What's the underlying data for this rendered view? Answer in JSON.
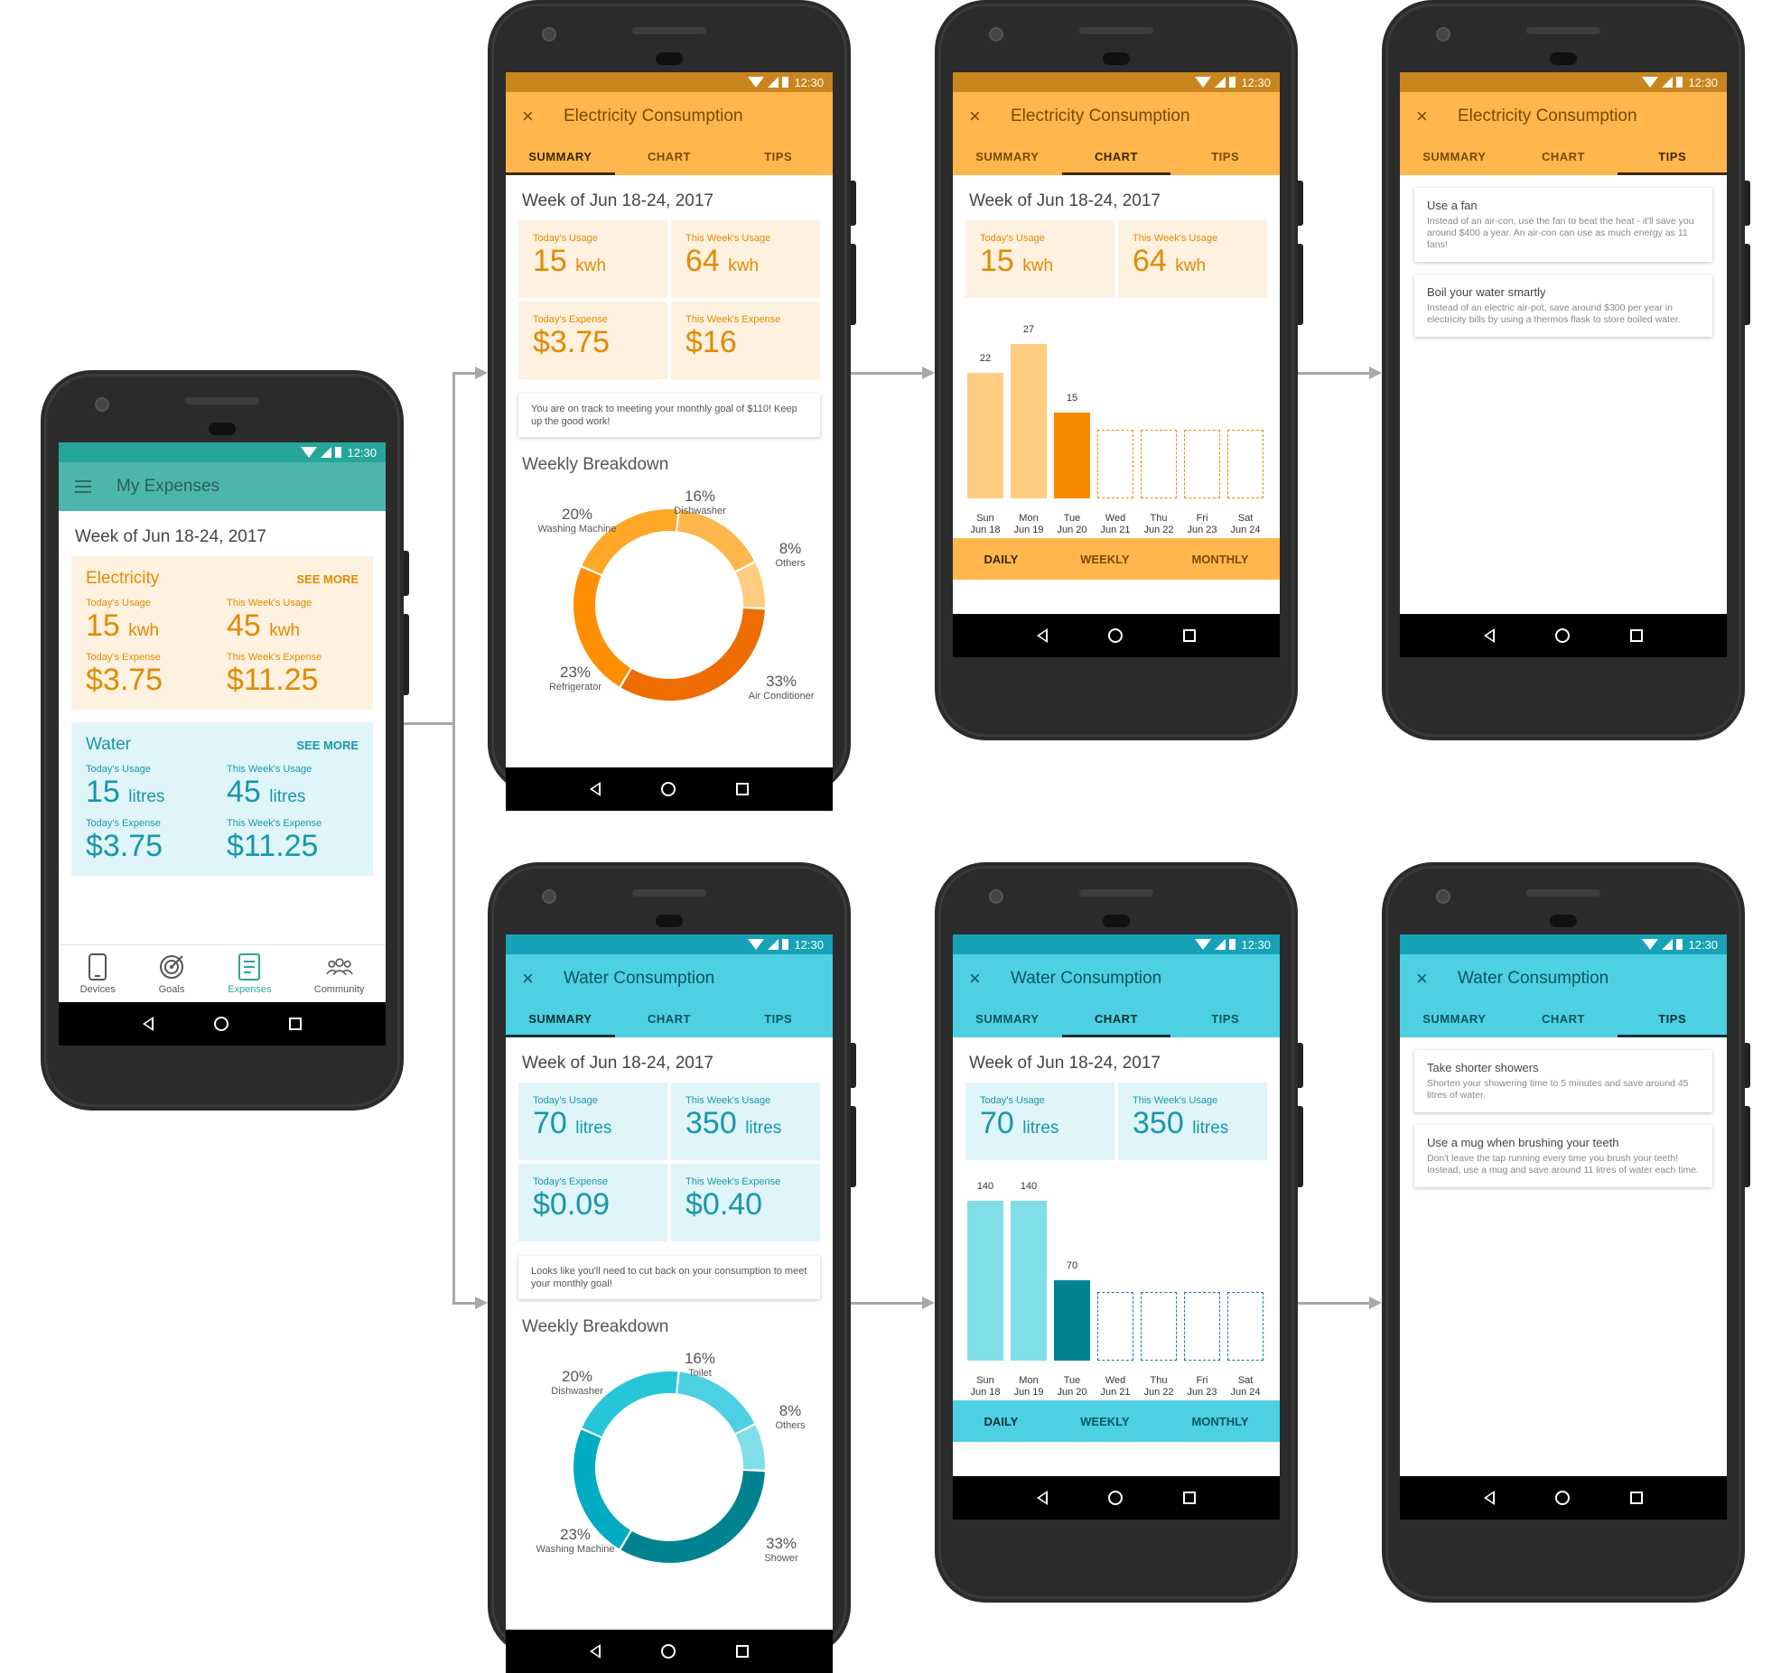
{
  "status": {
    "time": "12:30"
  },
  "colors": {
    "teal": "#4db6ac",
    "teal_dark": "#26a69a",
    "orange_bar": "#ffb74d",
    "orange_status": "#c9861f",
    "orange_accent": "#e08a00",
    "orange_light": "#fff1e0",
    "water_bar": "#4dd0e1",
    "water_status": "#17a2b8",
    "water_accent": "#1797ab",
    "water_light": "#e0f5f9"
  },
  "home": {
    "title": "My Expenses",
    "week": "Week of Jun 18-24, 2017",
    "see_more": "SEE MORE",
    "electricity": {
      "name": "Electricity",
      "today_usage_label": "Today's Usage",
      "today_usage": "15",
      "today_usage_unit": "kwh",
      "week_usage_label": "This Week's Usage",
      "week_usage": "45",
      "week_usage_unit": "kwh",
      "today_expense_label": "Today's Expense",
      "today_expense": "$3.75",
      "week_expense_label": "This Week's Expense",
      "week_expense": "$11.25"
    },
    "water": {
      "name": "Water",
      "today_usage_label": "Today's Usage",
      "today_usage": "15",
      "today_usage_unit": "litres",
      "week_usage_label": "This Week's Usage",
      "week_usage": "45",
      "week_usage_unit": "litres",
      "today_expense_label": "Today's Expense",
      "today_expense": "$3.75",
      "week_expense_label": "This Week's Expense",
      "week_expense": "$11.25"
    },
    "bottom_nav": [
      "Devices",
      "Goals",
      "Expenses",
      "Community"
    ]
  },
  "tabs": {
    "summary": "SUMMARY",
    "chart": "CHART",
    "tips": "TIPS"
  },
  "periods": {
    "daily": "DAILY",
    "weekly": "WEEKLY",
    "monthly": "MONTHLY"
  },
  "electricity": {
    "title": "Electricity Consumption",
    "week": "Week of Jun 18-24, 2017",
    "today_usage_label": "Today's Usage",
    "today_usage": "15",
    "usage_unit": "kwh",
    "week_usage_label": "This Week's Usage",
    "week_usage": "64",
    "today_expense_label": "Today's Expense",
    "today_expense": "$3.75",
    "week_expense_label": "This Week's Expense",
    "week_expense": "$16",
    "note": "You are on track to meeting your monthly goal of $110! Keep up the good work!",
    "breakdown_title": "Weekly Breakdown",
    "breakdown": [
      {
        "pct": "16%",
        "name": "Dishwasher"
      },
      {
        "pct": "8%",
        "name": "Others"
      },
      {
        "pct": "33%",
        "name": "Air Conditioner"
      },
      {
        "pct": "23%",
        "name": "Refrigerator"
      },
      {
        "pct": "20%",
        "name": "Washing Machine"
      }
    ],
    "tips": [
      {
        "title": "Use a fan",
        "desc": "Instead of an air-con, use the fan to beat the heat - it'll save you around $400 a year. An air-con can use as much energy as 11 fans!"
      },
      {
        "title": "Boil your water smartly",
        "desc": "Instead of an electric air-pot, save around $300 per year in electricity bills by using a thermos flask to store boiled water."
      }
    ]
  },
  "water": {
    "title": "Water Consumption",
    "week": "Week of Jun 18-24, 2017",
    "today_usage_label": "Today's Usage",
    "today_usage": "70",
    "usage_unit": "litres",
    "week_usage_label": "This Week's Usage",
    "week_usage": "350",
    "today_expense_label": "Today's Expense",
    "today_expense": "$0.09",
    "week_expense_label": "This Week's Expense",
    "week_expense": "$0.40",
    "note": "Looks like you'll need to cut back on your consumption to meet your monthly goal!",
    "breakdown_title": "Weekly Breakdown",
    "breakdown": [
      {
        "pct": "16%",
        "name": "Toilet"
      },
      {
        "pct": "8%",
        "name": "Others"
      },
      {
        "pct": "33%",
        "name": "Shower"
      },
      {
        "pct": "23%",
        "name": "Washing Machine"
      },
      {
        "pct": "20%",
        "name": "Dishwasher"
      }
    ],
    "tips": [
      {
        "title": "Take shorter showers",
        "desc": "Shorten your showering time to 5 minutes and save around 45 litres of water."
      },
      {
        "title": "Use a mug when brushing your teeth",
        "desc": "Don't leave the tap running every time you brush your teeth! Instead, use a mug and save around 11 litres of water each time."
      }
    ]
  },
  "chart_data": [
    {
      "type": "bar",
      "categories": [
        "Sun Jun 18",
        "Mon Jun 19",
        "Tue Jun 20",
        "Wed Jun 21",
        "Thu Jun 22",
        "Fri Jun 23",
        "Sat Jun 24"
      ],
      "days": [
        "Sun",
        "Mon",
        "Tue",
        "Wed",
        "Thu",
        "Fri",
        "Sat"
      ],
      "dates": [
        "Jun 18",
        "Jun 19",
        "Jun 20",
        "Jun 21",
        "Jun 22",
        "Jun 23",
        "Jun 24"
      ],
      "values": [
        22,
        27,
        15,
        null,
        null,
        null,
        null
      ],
      "ylim": [
        0,
        30
      ]
    },
    {
      "type": "bar",
      "categories": [
        "Sun Jun 18",
        "Mon Jun 19",
        "Tue Jun 20",
        "Wed Jun 21",
        "Thu Jun 22",
        "Fri Jun 23",
        "Sat Jun 24"
      ],
      "days": [
        "Sun",
        "Mon",
        "Tue",
        "Wed",
        "Thu",
        "Fri",
        "Sat"
      ],
      "dates": [
        "Jun 18",
        "Jun 19",
        "Jun 20",
        "Jun 21",
        "Jun 22",
        "Jun 23",
        "Jun 24"
      ],
      "values": [
        140,
        140,
        70,
        null,
        null,
        null,
        null
      ],
      "ylim": [
        0,
        150
      ]
    },
    {
      "type": "pie",
      "labels": [
        "Dishwasher",
        "Others",
        "Air Conditioner",
        "Refrigerator",
        "Washing Machine"
      ],
      "values": [
        16,
        8,
        33,
        23,
        20
      ]
    },
    {
      "type": "pie",
      "labels": [
        "Toilet",
        "Others",
        "Shower",
        "Washing Machine",
        "Dishwasher"
      ],
      "values": [
        16,
        8,
        33,
        23,
        20
      ]
    }
  ]
}
